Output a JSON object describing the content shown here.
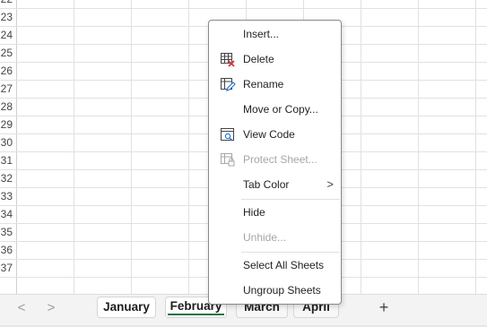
{
  "grid": {
    "row_numbers": [
      "22",
      "23",
      "24",
      "25",
      "26",
      "27",
      "28",
      "29",
      "30",
      "31",
      "32",
      "33",
      "34",
      "35",
      "36",
      "37"
    ]
  },
  "context_menu": {
    "items": [
      {
        "label": "Insert...",
        "enabled": true
      },
      {
        "label": "Delete",
        "enabled": true,
        "icon": "delete-sheet-icon"
      },
      {
        "label": "Rename",
        "enabled": true,
        "icon": "rename-sheet-icon"
      },
      {
        "label": "Move or Copy...",
        "enabled": true
      },
      {
        "label": "View Code",
        "enabled": true,
        "icon": "view-code-icon"
      },
      {
        "label": "Protect Sheet...",
        "enabled": false,
        "icon": "protect-sheet-icon"
      },
      {
        "label": "Tab Color",
        "enabled": true,
        "submenu_arrow": ">"
      },
      {
        "label": "Hide",
        "enabled": true
      },
      {
        "label": "Unhide...",
        "enabled": false
      },
      {
        "label": "Select All Sheets",
        "enabled": true
      },
      {
        "label": "Ungroup Sheets",
        "enabled": true
      }
    ]
  },
  "tabbar": {
    "prev_glyph": "<",
    "next_glyph": ">",
    "tabs": [
      {
        "label": "January"
      },
      {
        "label": "February",
        "active": true
      },
      {
        "label": "March"
      },
      {
        "label": "April"
      }
    ],
    "add_glyph": "+"
  },
  "colors": {
    "active_tab_underline": "#1e7145",
    "delete_icon_accent": "#d13438",
    "rename_icon_accent": "#2b7cd3"
  }
}
